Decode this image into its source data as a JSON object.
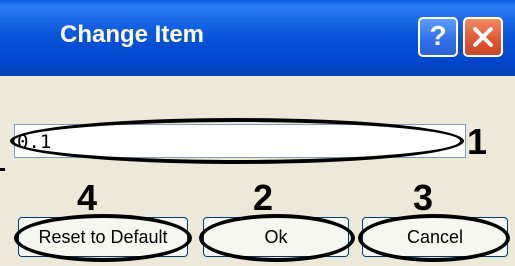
{
  "window": {
    "title": "Change Item",
    "help_label": "?",
    "close_icon": "close-icon"
  },
  "field": {
    "value": "0.1"
  },
  "annotations": {
    "field_number": "1",
    "ok_number": "2",
    "cancel_number": "3",
    "reset_number": "4"
  },
  "buttons": {
    "reset_label": "Reset to Default",
    "ok_label": "Ok",
    "cancel_label": "Cancel"
  },
  "colors": {
    "titlebar_blue": "#0a55d8",
    "close_red": "#e1542e",
    "dialog_bg": "#ece9d8",
    "annotation_black": "#000000"
  }
}
